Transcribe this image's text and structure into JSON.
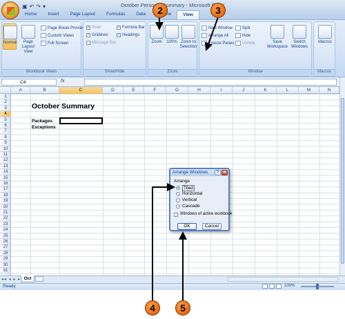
{
  "window": {
    "title": "October Personal Summary - Microsoft Excel"
  },
  "tabs": [
    "Home",
    "Insert",
    "Page Layout",
    "Formulas",
    "Data",
    "Review",
    "View"
  ],
  "ribbon": {
    "workbook_views": {
      "normal": "Normal",
      "page_layout": "Page Layout",
      "page_layout2": "View",
      "page_break": "Page Break Preview",
      "custom_views": "Custom Views",
      "full_screen": "Full Screen",
      "label": "Workbook Views"
    },
    "show_hide": {
      "ruler": "Ruler",
      "gridlines": "Gridlines",
      "message_bar": "Message Bar",
      "formula_bar": "Formula Bar",
      "headings": "Headings",
      "label": "Show/Hide"
    },
    "zoom": {
      "zoom": "Zoom",
      "hundred": "100%",
      "zoom_sel1": "Zoom to",
      "zoom_sel2": "Selection",
      "label": "Zoom"
    },
    "window": {
      "new_window": "New Window",
      "arrange_all": "Arrange All",
      "freeze": "Freeze Panes",
      "split": "Split",
      "hide": "Hide",
      "unhide": "Unhide",
      "save1": "Save",
      "save2": "Workspace",
      "switch1": "Switch",
      "switch2": "Windows",
      "label": "Window"
    },
    "macros": {
      "macros": "Macros",
      "label": "Macros"
    }
  },
  "formula_bar": {
    "name_box": "C4",
    "fx": "fx"
  },
  "columns": [
    "A",
    "B",
    "C",
    "D",
    "E",
    "F",
    "G",
    "H",
    "I",
    "J",
    "K",
    "L",
    "M",
    "N"
  ],
  "rows": [
    "1",
    "2",
    "3",
    "4",
    "5",
    "6",
    "7",
    "8",
    "9",
    "10",
    "11",
    "12",
    "13",
    "14",
    "15",
    "16",
    "17",
    "18",
    "19",
    "20",
    "21",
    "22",
    "23",
    "24",
    "25",
    "26",
    "27",
    "28",
    "29",
    "30",
    "31"
  ],
  "cells": {
    "title": "October Summary",
    "packages": "Packages",
    "exceptions": "Exceptions"
  },
  "sheet": {
    "tab": "Oct"
  },
  "status": {
    "text": "Ready",
    "zoom": "100%"
  },
  "dialog": {
    "title": "Arrange Windows",
    "group": "Arrange",
    "options": [
      "Tiled",
      "Horizontal",
      "Vertical",
      "Cascade"
    ],
    "selected": "Tiled",
    "checkbox": "Windows of active workbook",
    "ok": "OK",
    "cancel": "Cancel"
  },
  "callouts": [
    "2",
    "3",
    "4",
    "5"
  ]
}
